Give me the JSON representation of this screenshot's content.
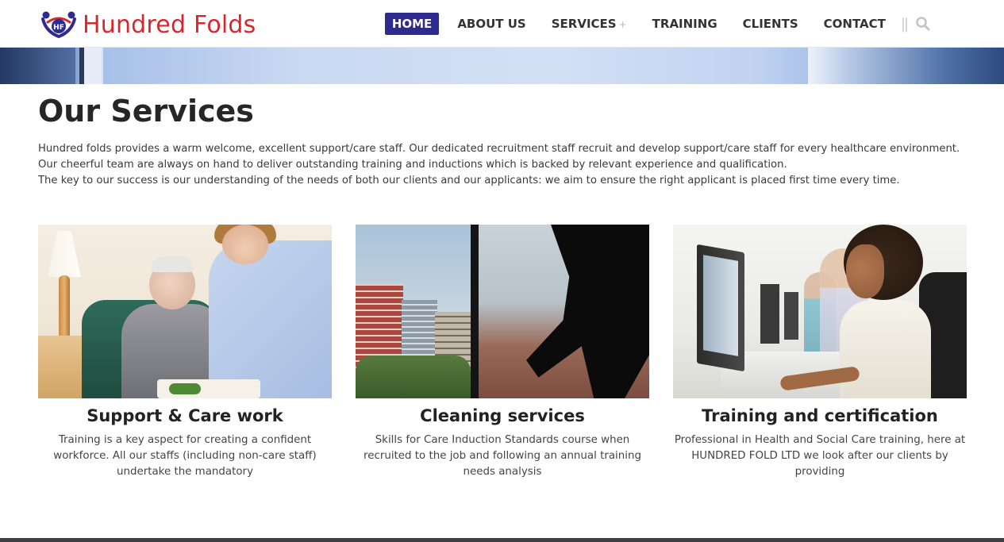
{
  "brand": {
    "name": "Hundred Folds",
    "logo_initials": "HF",
    "color": "#d4282e",
    "logo_icon": "people-logo-icon"
  },
  "nav": {
    "items": [
      {
        "label": "HOME",
        "active": true
      },
      {
        "label": "ABOUT US",
        "active": false
      },
      {
        "label": "SERVICES",
        "active": false,
        "has_submenu": true,
        "submenu_indicator": "+"
      },
      {
        "label": "TRAINING",
        "active": false
      },
      {
        "label": "CLIENTS",
        "active": false
      },
      {
        "label": "CONTACT",
        "active": false
      }
    ],
    "separator": "||",
    "search_icon": "search-icon",
    "active_color": "#2e2a8f"
  },
  "page": {
    "title": "Our Services",
    "intro": [
      "Hundred folds provides a warm welcome, excellent support/care staff. Our dedicated recruitment staff recruit and develop support/care staff for every healthcare environment.",
      "Our cheerful team are always on hand to deliver outstanding training and inductions which is backed by relevant experience and qualification.",
      "The key to our success is our understanding of the needs of both our clients and our applicants: we aim to ensure the right applicant is placed first time every time."
    ]
  },
  "services": [
    {
      "title": "Support & Care work",
      "text": "Training is a key aspect for creating a confident workforce. All our staffs (including non-care staff) undertake the mandatory"
    },
    {
      "title": "Cleaning services",
      "text": "Skills for Care Induction Standards course when recruited to the job and following an annual training needs analysis"
    },
    {
      "title": "Training and certification",
      "text": "Professional in Health and Social Care training, here at HUNDRED FOLD LTD we look after our clients by providing"
    }
  ]
}
